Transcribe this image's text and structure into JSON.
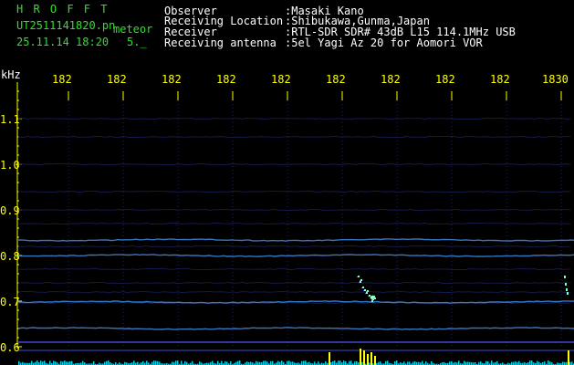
{
  "header": {
    "logo_text": "H R O F F T",
    "filename": "UT2511141820.pn",
    "meteor_label": "meteor",
    "datetime": "25.11.14 18:20",
    "slot": "5._",
    "info_keys": [
      "Observer",
      "Receiving Location",
      "Receiver",
      "Receiving antenna"
    ],
    "info_values": [
      ":Masaki Kano",
      ":Shibukawa,Gunma,Japan",
      ":RTL-SDR SDR# 43dB L15 114.1MHz USB",
      ":5el Yagi Az 20 for Aomori VOR"
    ]
  },
  "axes": {
    "y_unit": "kHz",
    "y_ticks": [
      "1.1",
      "1.0",
      "0.9",
      "0.8",
      "0.7",
      "0.6"
    ],
    "x_ticks": [
      "182",
      "182",
      "182",
      "182",
      "182",
      "182",
      "182",
      "182",
      "182",
      "1830"
    ]
  },
  "colors": {
    "background": "#000000",
    "header_text": "#ffffff",
    "logo": "#2fe02f",
    "time_labels": "#ffff00",
    "trace_low": "#1b2a8a",
    "trace_high": "#4a9cff",
    "meteor": "#7fffd4",
    "spectrum": "#00e5ff",
    "spike": "#ffff00"
  }
}
